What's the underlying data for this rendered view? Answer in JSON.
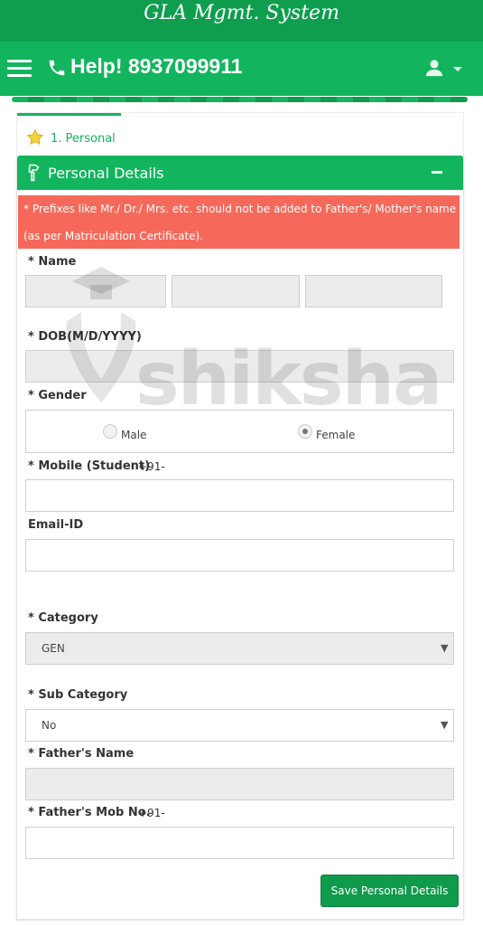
{
  "app": {
    "title": "GLA Mgmt. System"
  },
  "nav": {
    "help_text": "Help! 8937099911"
  },
  "tab": {
    "label": "1. Personal"
  },
  "panel": {
    "title": "Personal Details",
    "notice_line1": "* Prefixes like Mr./ Dr./ Mrs. etc. should not be added to Father's/ Mother's name",
    "notice_line2": "(as per Matriculation Certificate)."
  },
  "form": {
    "name_label": "* Name",
    "dob_label": "* DOB(M/D/YYYY)",
    "gender_label": "* Gender",
    "gender_options": [
      "Male",
      "Female"
    ],
    "gender_selected": "Female",
    "mobile_label": "* Mobile (Student)",
    "mobile_prefix": "+91-",
    "email_label": "Email-ID",
    "category_label": "* Category",
    "category_value": "GEN",
    "subcategory_label": "* Sub Category",
    "subcategory_value": "No",
    "father_name_label": "* Father's Name",
    "father_mob_label": "* Father's Mob No.",
    "father_mob_prefix": "+91-",
    "save_label": "Save Personal Details"
  },
  "watermark": {
    "text": "shiksha"
  },
  "colors": {
    "brand_dark": "#0e9e4e",
    "brand": "#12b55d",
    "notice": "#f6695a",
    "button": "#0f9a4c"
  }
}
